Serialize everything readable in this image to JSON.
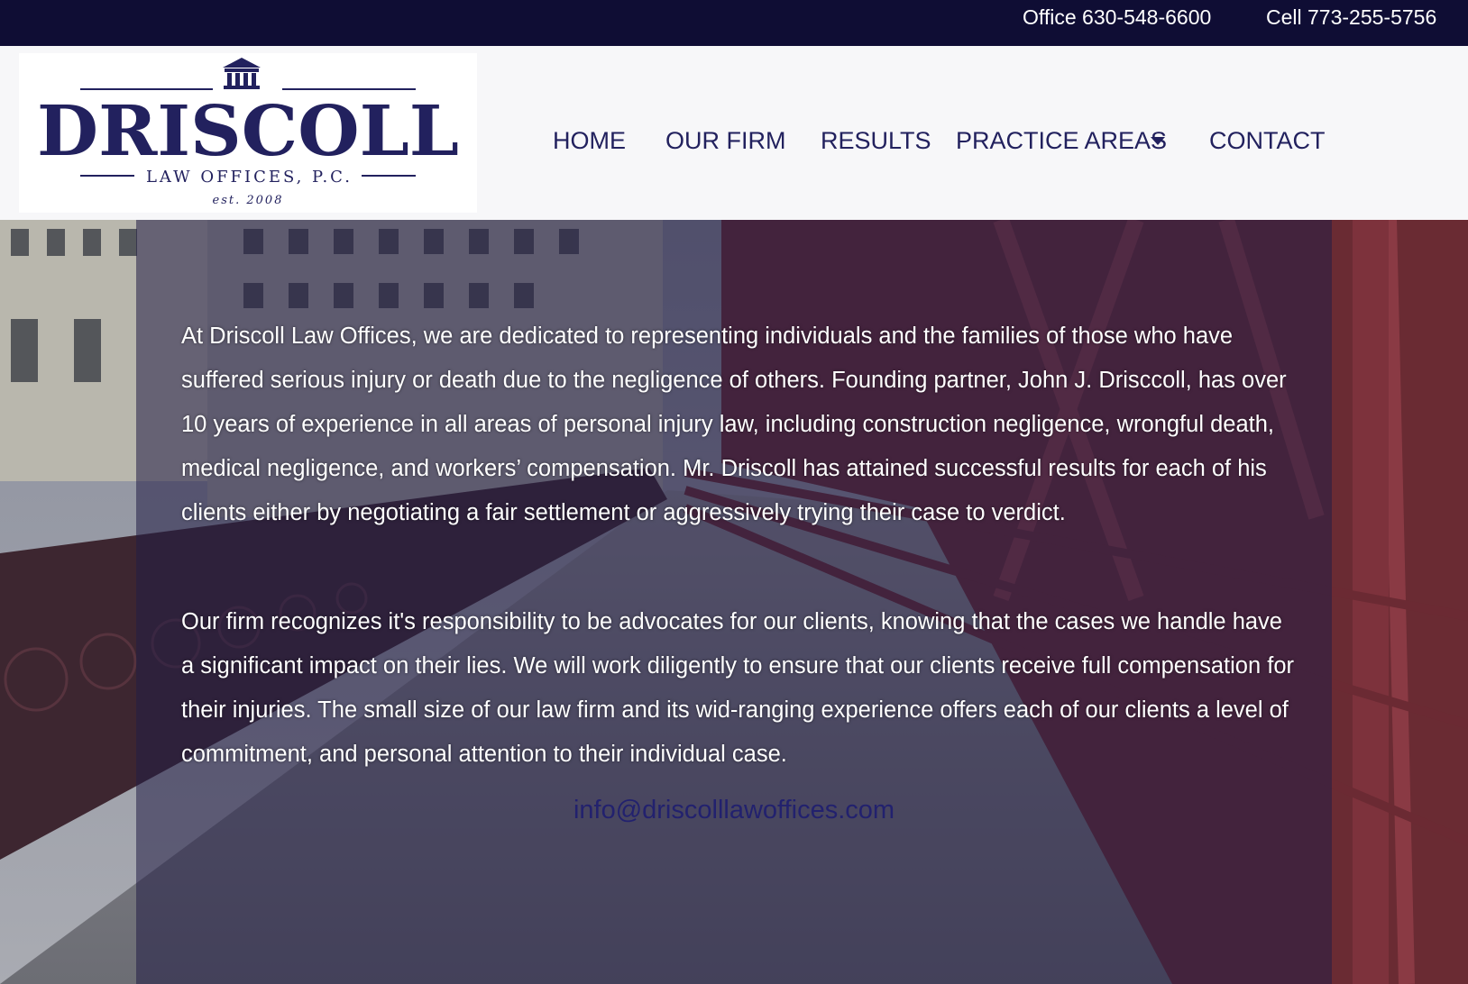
{
  "topbar": {
    "office": "Office 630-548-6600",
    "cell": "Cell 773-255-5756"
  },
  "logo": {
    "name": "DRISCOLL",
    "sub": "LAW OFFICES, P.C.",
    "est": "est. 2008"
  },
  "nav": {
    "items": [
      {
        "label": "HOME"
      },
      {
        "label": "OUR FIRM"
      },
      {
        "label": "RESULTS"
      },
      {
        "label": "PRACTICE AREAS",
        "has_dropdown": true
      },
      {
        "label": "CONTACT"
      }
    ]
  },
  "content": {
    "paragraph1": "At Driscoll Law Offices, we are dedicated to representing individuals and the families of those who have suffered serious injury or death due to the negligence of others. Founding partner, John J. Drisccoll, has over 10 years of experience in all areas of personal injury law, including construction negligence, wrongful death, medical negligence, and workers’ compensation. Mr. Driscoll has attained successful results for each of his clients either by negotiating a fair settlement or aggressively trying their case to verdict.",
    "paragraph2": "Our firm recognizes it's responsibility to be advocates for our clients, knowing that the cases we handle have a significant impact on their lies. We will work diligently to ensure that our clients receive full compensation for their injuries. The small size of our law firm and its wid-ranging experience offers each of our clients a level of commitment, and personal attention to their individual case.",
    "email": "info@driscolllawoffices.com"
  },
  "colors": {
    "topbar_bg": "#0f0d34",
    "brand_navy": "#22215e",
    "header_bg": "#f7f7f9",
    "overlay": "rgba(34,30,70,0.55)",
    "bridge_red": "#7a2e3a"
  },
  "icons": {
    "logo_emblem": "courthouse-icon",
    "dropdown": "caret-down-icon"
  }
}
